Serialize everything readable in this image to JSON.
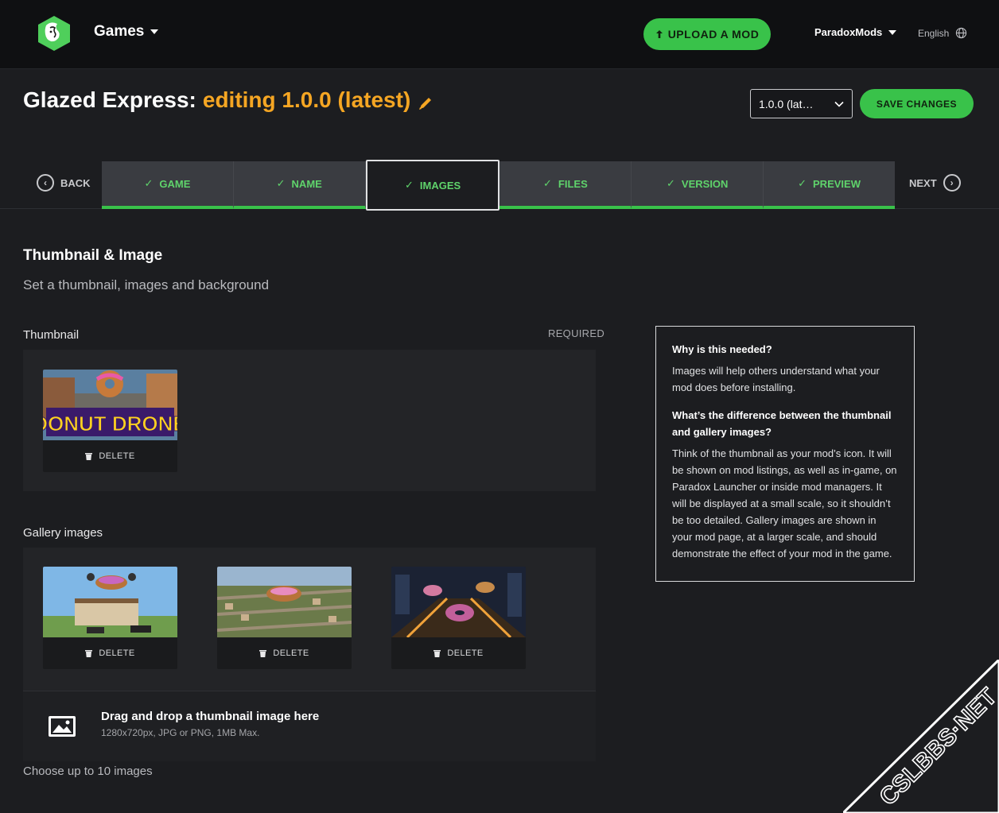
{
  "topbar": {
    "games_label": "Games",
    "upload_label": "UPLOAD A MOD",
    "user_label": "ParadoxMods",
    "language_label": "English"
  },
  "header": {
    "title_name": "Glazed Express:",
    "title_editing": "editing 1.0.0 (latest)",
    "version_select_value": "1.0.0 (lat…",
    "save_label": "SAVE CHANGES"
  },
  "stepper": {
    "back_label": "BACK",
    "next_label": "NEXT",
    "steps": [
      {
        "label": "GAME"
      },
      {
        "label": "NAME"
      },
      {
        "label": "IMAGES"
      },
      {
        "label": "FILES"
      },
      {
        "label": "VERSION"
      },
      {
        "label": "PREVIEW"
      }
    ],
    "active_step": "IMAGES"
  },
  "section": {
    "title": "Thumbnail & Image",
    "subtitle": "Set a thumbnail, images and background"
  },
  "thumbnail": {
    "label": "Thumbnail",
    "required_label": "REQUIRED",
    "image_text": "DONUT DRONE",
    "delete_label": "DELETE"
  },
  "gallery": {
    "label": "Gallery images",
    "items": [
      {
        "delete_label": "DELETE"
      },
      {
        "delete_label": "DELETE"
      },
      {
        "delete_label": "DELETE"
      }
    ],
    "dropzone_title": "Drag and drop a thumbnail image here",
    "dropzone_sub": "1280x720px, JPG or PNG, 1MB Max.",
    "choose_label": "Choose up to 10 images"
  },
  "help": {
    "q1": "Why is this needed?",
    "a1": "Images will help others understand what your mod does before installing.",
    "q2": "What’s the difference between the thumbnail and gallery images?",
    "a2": "Think of the thumbnail as your mod’s icon. It will be shown on mod listings, as well as in-game, on Paradox Launcher or inside mod managers. It will be displayed at a small scale, so it shouldn’t be too detailed. Gallery images are shown in your mod page, at a larger scale, and should demonstrate the effect of your mod in the game."
  },
  "watermark": "CSLBBS·NET",
  "colors": {
    "accent_green": "#39c24a",
    "accent_orange": "#f5a623",
    "background": "#1c1d20",
    "topbar": "#0f1012"
  }
}
